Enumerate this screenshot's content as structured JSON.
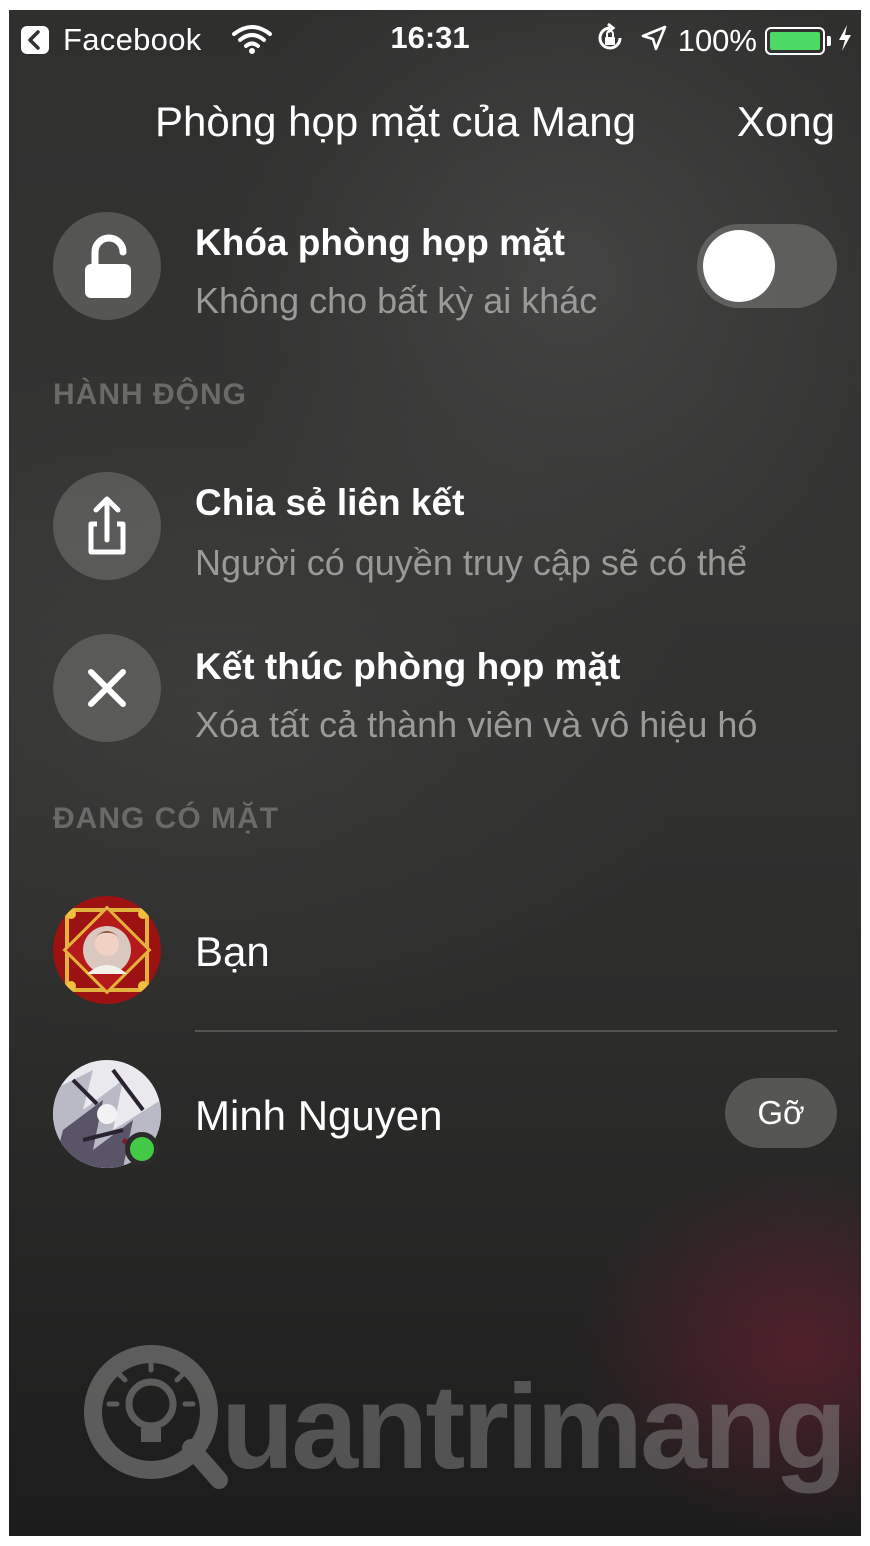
{
  "status_bar": {
    "back_app": "Facebook",
    "time": "16:31",
    "battery": "100%",
    "battery_level": 1.0,
    "icons": [
      "back-chevron-icon",
      "wifi-icon",
      "rotation-lock-icon",
      "location-arrow-icon",
      "battery-icon",
      "charging-bolt-icon"
    ]
  },
  "header": {
    "title": "Phòng họp mặt của Mang",
    "done_label": "Xong"
  },
  "lock_room": {
    "title": "Khóa phòng họp mặt",
    "subtitle": "Không cho bất kỳ ai khác",
    "toggle_on": false,
    "icon": "lock-open-icon"
  },
  "actions": {
    "header": "HÀNH ĐỘNG",
    "items": [
      {
        "title": "Chia sẻ liên kết",
        "subtitle": "Người có quyền truy cập sẽ có thể",
        "icon": "share-icon"
      },
      {
        "title": "Kết thúc phòng họp mặt",
        "subtitle": "Xóa tất cả thành viên và vô hiệu hó",
        "icon": "close-icon"
      }
    ]
  },
  "present": {
    "header": "ĐANG CÓ MẶT",
    "members": [
      {
        "name": "Bạn",
        "online": false
      },
      {
        "name": "Minh Nguyen",
        "online": true,
        "remove_label": "Gỡ"
      }
    ]
  },
  "watermark": {
    "text": "uantrimang",
    "icon": "lightbulb-q-logo"
  },
  "colors": {
    "online": "#44c947",
    "battery": "#4cd964",
    "secondary_text": "#9a9a98",
    "section_header": "#6a6a68"
  }
}
